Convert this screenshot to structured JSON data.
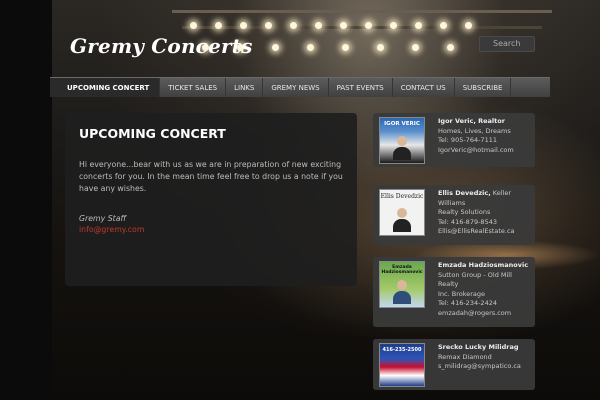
{
  "header": {
    "logo": "Gremy Concerts",
    "search_placeholder": "Search"
  },
  "nav": {
    "items": [
      {
        "label": "UPCOMING CONCERT",
        "active": true
      },
      {
        "label": "TICKET SALES",
        "active": false
      },
      {
        "label": "LINKS",
        "active": false
      },
      {
        "label": "GREMY NEWS",
        "active": false
      },
      {
        "label": "PAST EVENTS",
        "active": false
      },
      {
        "label": "CONTACT US",
        "active": false
      },
      {
        "label": "SUBSCRIBE",
        "active": false
      }
    ]
  },
  "main": {
    "title": "UPCOMING CONCERT",
    "text": "Hi everyone...bear with us as we are in preparation of new exciting concerts for you. In the mean time feel free to drop us a note if you have any wishes.",
    "signature": "Gremy Staff",
    "email": "info@gremy.com"
  },
  "sidebar": {
    "cards": [
      {
        "photo_label": "IGOR VERIC",
        "name": "Igor Veric, Realtor",
        "lines": [
          "Homes, Lives, Dreams",
          "Tel: 905-764-7111",
          "IgorVeric@hotmail.com"
        ]
      },
      {
        "photo_label": "Ellis Devedzic",
        "name": "Ellis Devedzic,",
        "name_suffix": " Keller Williams",
        "lines": [
          "Realty Solutions",
          "Tel: 416-879-8543",
          "Ellis@EllisRealEstate.ca"
        ]
      },
      {
        "photo_label": "Emzada Hadziosmanovic",
        "name": "Emzada Hadziosmanovic",
        "lines": [
          "Sutton Group - Old Mill Realty",
          "Inc. Brokerage",
          "Tel: 416-234-2424",
          "emzadah@rogers.com"
        ]
      },
      {
        "photo_label": "416-235-2500",
        "name": "Srecko Lucky Milidrag",
        "lines": [
          "Remax Diamond",
          "s_milidrag@sympatico.ca"
        ]
      }
    ]
  },
  "colors": {
    "accent_link": "#c0392b",
    "nav_bg": "#4a4a4a",
    "panel_bg": "#1e1e1e"
  }
}
